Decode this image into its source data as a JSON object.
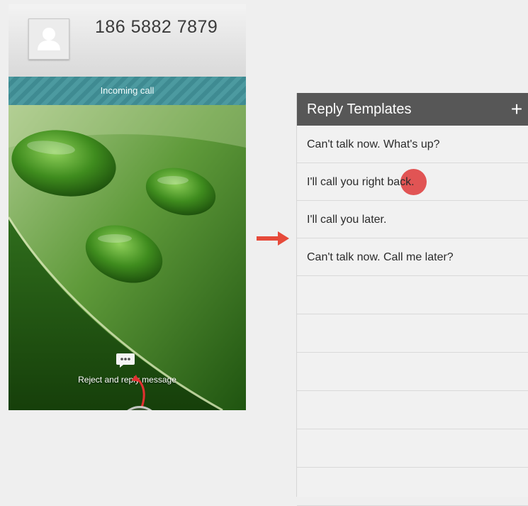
{
  "phone": {
    "caller_number": "186 5882 7879",
    "call_status": "Incoming call",
    "reject_message_label": "Reject and reply message",
    "icons": {
      "avatar": "person-silhouette",
      "message": "chat-bubble-icon",
      "decline": "phone-hangup-icon",
      "accept": "phone-answer-icon"
    },
    "colors": {
      "decline": "#d9312c",
      "accept": "#2f9a3c",
      "answer_dot": "#d8262b",
      "status_bar": "#4c9aa0"
    }
  },
  "transition_arrow": {
    "icon": "arrow-right-icon",
    "color": "#e64a3a"
  },
  "reply_templates": {
    "title": "Reply Templates",
    "add_label": "+",
    "items": [
      "Can't talk now. What's up?",
      "I'll call you right back.",
      "I'll call you later.",
      "Can't talk now. Call me later?"
    ],
    "colors": {
      "header": "#575757",
      "tap_indicator": "#dc2828"
    }
  }
}
